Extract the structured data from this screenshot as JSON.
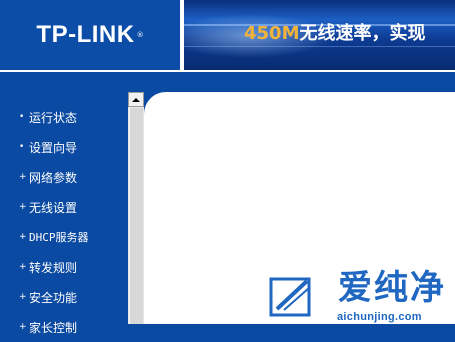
{
  "header": {
    "logo": "TP-LINK",
    "logo_mark": "®",
    "banner": {
      "speed": "450M",
      "slogan": "无线速率，实现"
    }
  },
  "sidebar": {
    "items": [
      {
        "bullet": "•",
        "label": "运行状态"
      },
      {
        "bullet": "•",
        "label": "设置向导"
      },
      {
        "bullet": "+",
        "label": "网络参数"
      },
      {
        "bullet": "+",
        "label": "无线设置"
      },
      {
        "bullet": "+",
        "label": "DHCP服务器"
      },
      {
        "bullet": "+",
        "label": "转发规则"
      },
      {
        "bullet": "+",
        "label": "安全功能"
      },
      {
        "bullet": "+",
        "label": "家长控制"
      }
    ]
  },
  "watermark": {
    "name": "爱纯净",
    "url": "aichunjing.com"
  },
  "colors": {
    "nav_blue": "#0b4aa2",
    "logo_blue": "#0c4da8",
    "banner_orange": "#f2b33a",
    "watermark_blue": "#1f67c1"
  }
}
